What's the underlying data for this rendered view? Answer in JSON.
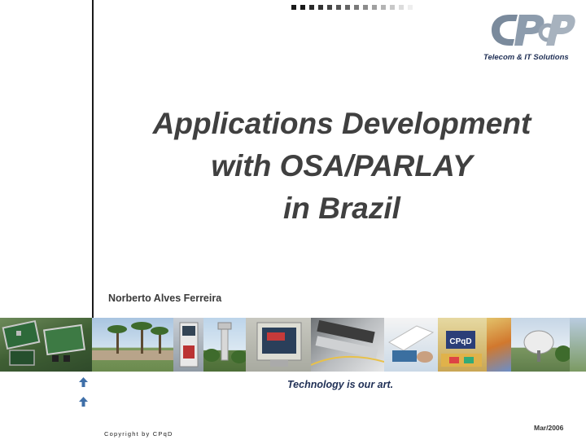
{
  "header": {
    "logo_name": "CPqD",
    "logo_subtitle": "Telecom & IT Solutions",
    "dot_colors": [
      "#1a1a1a",
      "#1a1a1a",
      "#2a2a2a",
      "#333333",
      "#444444",
      "#555555",
      "#666666",
      "#7a7a7a",
      "#8c8c8c",
      "#a0a0a0",
      "#b4b4b4",
      "#c8c8c8",
      "#dcdcdc",
      "#eeeeee"
    ]
  },
  "slide": {
    "title_line1": "Applications Development",
    "title_line2": "with OSA/PARLAY",
    "title_line3": "in Brazil",
    "author": "Norberto Alves Ferreira"
  },
  "footer": {
    "tagline": "Technology is our art.",
    "copyright": "Copyright by CPqD",
    "date": "Mar/2006"
  },
  "colors": {
    "title": "#404040",
    "brand_navy": "#1f2f55",
    "arrow_blue": "#3f6fa8"
  },
  "photo_strip": [
    {
      "name": "circuit-board-photo"
    },
    {
      "name": "campus-palm-trees-photo"
    },
    {
      "name": "kiosk-terminal-photo"
    },
    {
      "name": "communication-tower-photo"
    },
    {
      "name": "computer-monitor-photo"
    },
    {
      "name": "optical-fiber-equipment-photo"
    },
    {
      "name": "lab-hands-photo"
    },
    {
      "name": "satellite-dish-photo"
    },
    {
      "name": "cpqd-building-sign-photo"
    },
    {
      "name": "colorful-cards-photo"
    },
    {
      "name": "antenna-dish-photo"
    }
  ]
}
